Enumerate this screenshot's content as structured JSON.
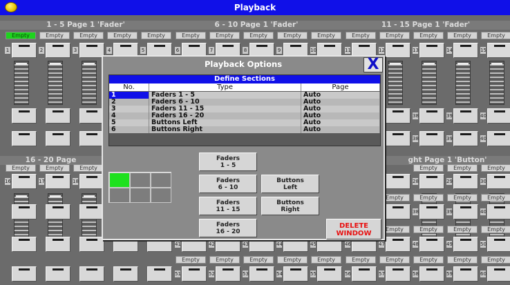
{
  "window": {
    "title": "Playback"
  },
  "banks": {
    "top": [
      {
        "label": "1 - 5 Page 1 'Fader'"
      },
      {
        "label": "6 - 10 Page 1 'Fader'"
      },
      {
        "label": "11 - 15 Page 1 'Fader'"
      }
    ],
    "bottom": [
      {
        "label": "16 - 20 Page"
      },
      {
        "label": "ght Page 1 'Button'"
      }
    ]
  },
  "slot_label": "Empty",
  "top_keys": [
    "1",
    "2",
    "3",
    "4",
    "5",
    "6",
    "7",
    "8",
    "9",
    "10",
    "11",
    "12",
    "13",
    "14",
    "15"
  ],
  "mid_keys": [
    "16",
    "17",
    "18",
    "",
    "",
    "",
    "",
    "",
    "",
    "",
    "",
    "",
    "28",
    "29",
    "30"
  ],
  "row_keys_a": [
    "",
    "",
    "",
    "",
    "",
    "",
    "",
    "",
    "",
    "",
    "",
    "",
    "38",
    "39",
    "40"
  ],
  "row_keys_b": [
    "",
    "",
    "",
    "",
    "",
    "41",
    "42",
    "43",
    "44",
    "45",
    "46",
    "47",
    "48",
    "49",
    "50"
  ],
  "row_keys_c": [
    "",
    "",
    "",
    "",
    "",
    "51",
    "52",
    "53",
    "54",
    "55",
    "56",
    "57",
    "58",
    "59",
    "60"
  ],
  "dialog": {
    "title": "Playback Options",
    "close_label": "X",
    "sections": {
      "title": "Define Sections",
      "headers": {
        "no": "No.",
        "type": "Type",
        "page": "Page"
      },
      "rows": [
        {
          "no": "1",
          "type": "Faders  1  -  5",
          "page": "Auto"
        },
        {
          "no": "2",
          "type": "Faders  6  -  10",
          "page": "Auto"
        },
        {
          "no": "3",
          "type": "Faders  11  -  15",
          "page": "Auto"
        },
        {
          "no": "4",
          "type": "Faders  16  -  20",
          "page": "Auto"
        },
        {
          "no": "5",
          "type": "Buttons Left",
          "page": "Auto"
        },
        {
          "no": "6",
          "type": "Buttons Right",
          "page": "Auto"
        }
      ]
    },
    "buttons": {
      "faders_1_5": "Faders\n1 - 5",
      "faders_6_10": "Faders\n6 - 10",
      "faders_11_15": "Faders\n11 - 15",
      "faders_16_20": "Faders\n16 - 20",
      "buttons_left": "Buttons\nLeft",
      "buttons_right": "Buttons\nRight",
      "delete_window": "DELETE\nWINDOW"
    }
  },
  "colors": {
    "titlebar": "#1010e8",
    "active_slot": "#1ed31e",
    "delete_text": "#e81010",
    "selected_row": "#1010e8"
  }
}
